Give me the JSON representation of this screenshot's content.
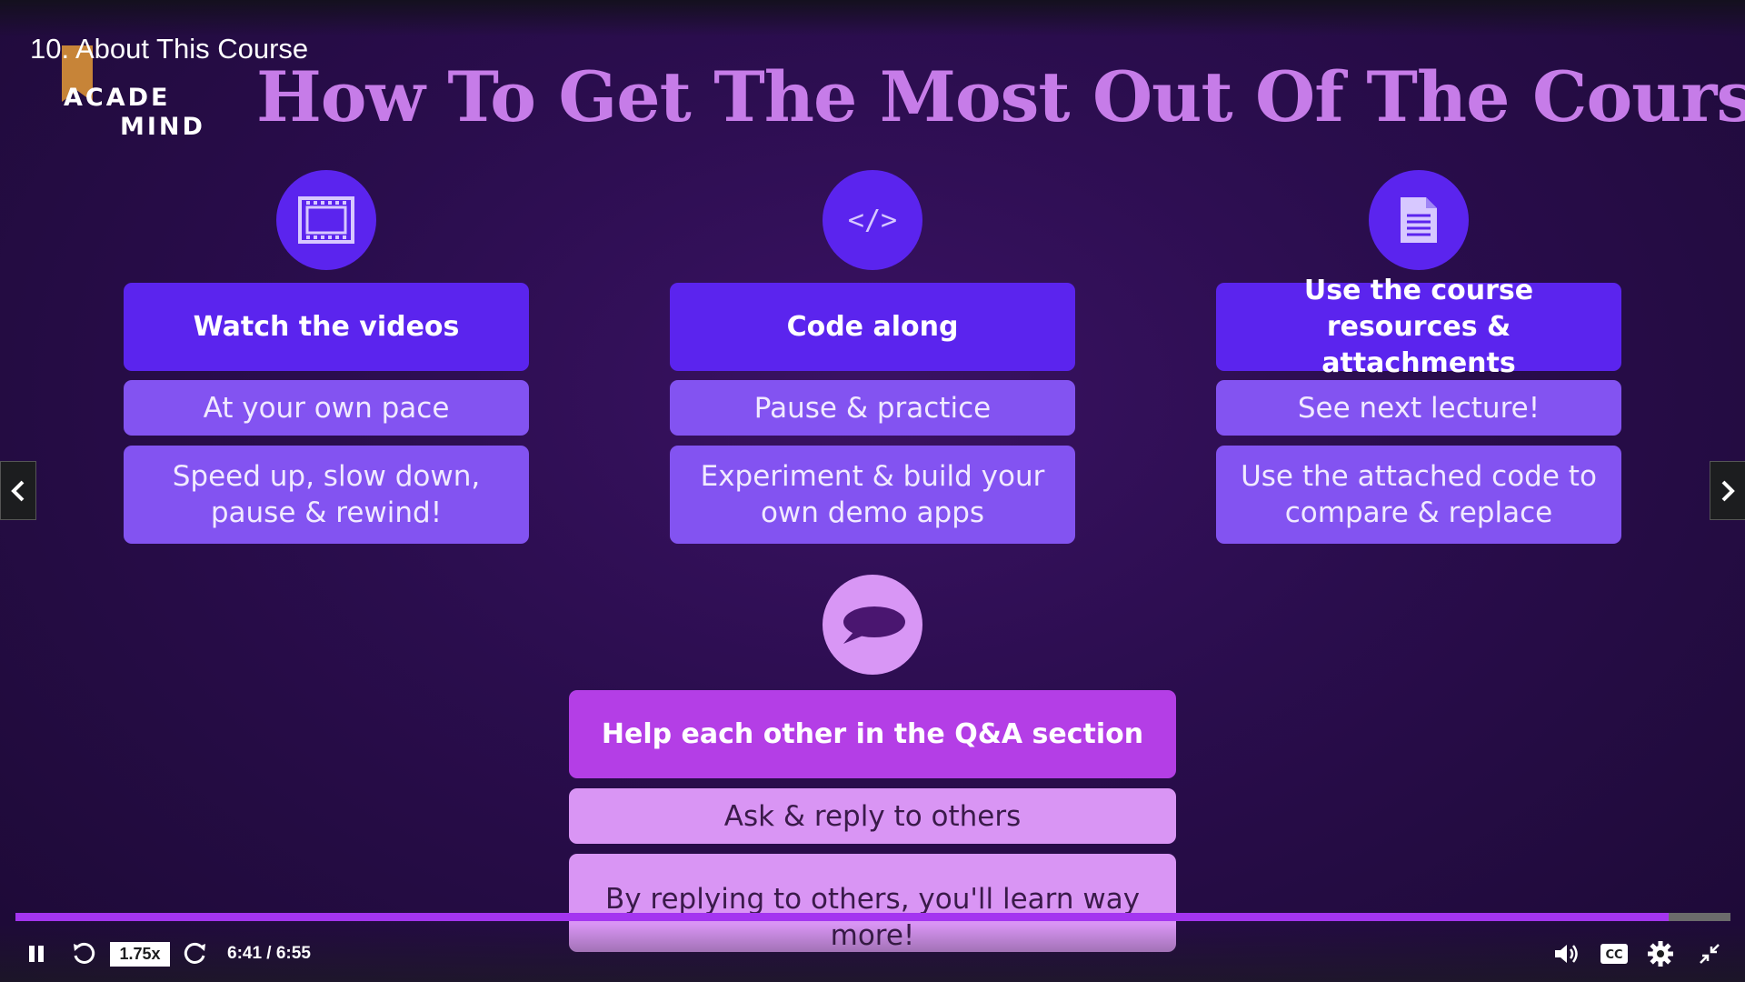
{
  "lecture_title": "10. About This Course",
  "slide": {
    "logo": {
      "line1": "ACADE",
      "line2": "MIND"
    },
    "heading": "How To Get The Most Out Of The Course",
    "columns": [
      {
        "icon": "film-icon",
        "title": "Watch the videos",
        "point1": "At your own pace",
        "point2": "Speed up, slow down, pause & rewind!"
      },
      {
        "icon": "code-icon",
        "title": "Code along",
        "point1": "Pause & practice",
        "point2": "Experiment & build your own demo apps"
      },
      {
        "icon": "document-icon",
        "title": "Use the course resources & attachments",
        "point1": "See next lecture!",
        "point2": "Use the attached code to compare & replace"
      }
    ],
    "qa": {
      "icon": "speech-bubble-icon",
      "title": "Help each other in the Q&A section",
      "point1": "Ask & reply to others",
      "point2": "By replying to others, you'll learn way more!"
    }
  },
  "player": {
    "speed": "1.75x",
    "time": "6:41 / 6:55",
    "progress": 0.964,
    "accent": "#a435f0"
  }
}
